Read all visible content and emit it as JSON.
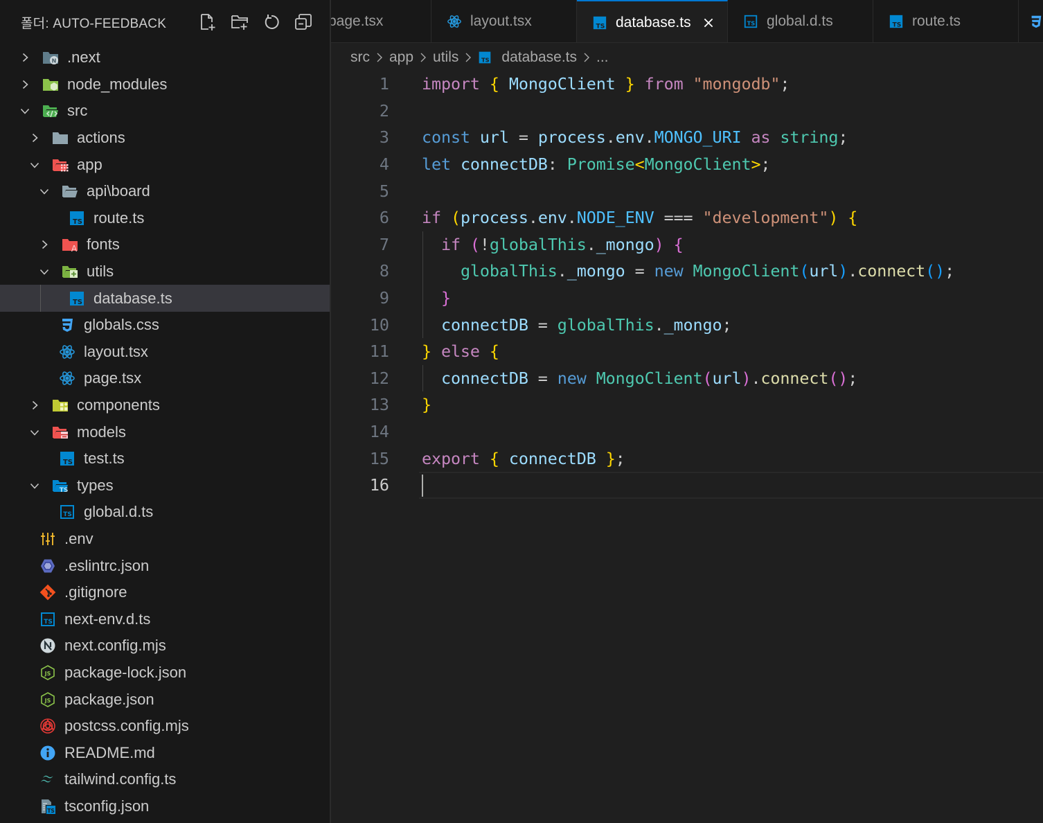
{
  "sidebar": {
    "title": "폴더: AUTO-FEEDBACK",
    "actions": [
      {
        "name": "new-file",
        "label": "New File"
      },
      {
        "name": "new-folder",
        "label": "New Folder"
      },
      {
        "name": "refresh",
        "label": "Refresh Explorer"
      },
      {
        "name": "collapse-all",
        "label": "Collapse Folders"
      }
    ],
    "tree": [
      {
        "label": ".next",
        "type": "folder",
        "depth": 0,
        "expanded": false,
        "icon": "next-folder-icon"
      },
      {
        "label": "node_modules",
        "type": "folder",
        "depth": 0,
        "expanded": false,
        "icon": "node-folder-icon"
      },
      {
        "label": "src",
        "type": "folder",
        "depth": 0,
        "expanded": true,
        "icon": "src-folder-icon"
      },
      {
        "label": "actions",
        "type": "folder",
        "depth": 1,
        "expanded": false,
        "icon": "folder-icon"
      },
      {
        "label": "app",
        "type": "folder",
        "depth": 1,
        "expanded": true,
        "icon": "app-folder-icon"
      },
      {
        "label": "api\\board",
        "type": "folder",
        "depth": 2,
        "expanded": true,
        "icon": "open-folder-icon"
      },
      {
        "label": "route.ts",
        "type": "file",
        "depth": 3,
        "icon": "typescript-icon"
      },
      {
        "label": "fonts",
        "type": "folder",
        "depth": 2,
        "expanded": false,
        "icon": "fonts-folder-icon"
      },
      {
        "label": "utils",
        "type": "folder",
        "depth": 2,
        "expanded": true,
        "icon": "utils-folder-icon"
      },
      {
        "label": "database.ts",
        "type": "file",
        "depth": 3,
        "icon": "typescript-icon",
        "selected": true
      },
      {
        "label": "globals.css",
        "type": "file",
        "depth": 2,
        "icon": "css-icon"
      },
      {
        "label": "layout.tsx",
        "type": "file",
        "depth": 2,
        "icon": "react-icon"
      },
      {
        "label": "page.tsx",
        "type": "file",
        "depth": 2,
        "icon": "react-icon"
      },
      {
        "label": "components",
        "type": "folder",
        "depth": 1,
        "expanded": false,
        "icon": "components-folder-icon"
      },
      {
        "label": "models",
        "type": "folder",
        "depth": 1,
        "expanded": true,
        "icon": "models-folder-icon"
      },
      {
        "label": "test.ts",
        "type": "file",
        "depth": 2,
        "icon": "typescript-icon"
      },
      {
        "label": "types",
        "type": "folder",
        "depth": 1,
        "expanded": true,
        "icon": "types-folder-icon"
      },
      {
        "label": "global.d.ts",
        "type": "file",
        "depth": 2,
        "icon": "typescript-def-icon"
      },
      {
        "label": ".env",
        "type": "file",
        "depth": 0,
        "icon": "env-icon"
      },
      {
        "label": ".eslintrc.json",
        "type": "file",
        "depth": 0,
        "icon": "eslint-icon"
      },
      {
        "label": ".gitignore",
        "type": "file",
        "depth": 0,
        "icon": "git-icon"
      },
      {
        "label": "next-env.d.ts",
        "type": "file",
        "depth": 0,
        "icon": "typescript-def-icon"
      },
      {
        "label": "next.config.mjs",
        "type": "file",
        "depth": 0,
        "icon": "nextjs-icon"
      },
      {
        "label": "package-lock.json",
        "type": "file",
        "depth": 0,
        "icon": "nodejs-icon"
      },
      {
        "label": "package.json",
        "type": "file",
        "depth": 0,
        "icon": "nodejs-icon"
      },
      {
        "label": "postcss.config.mjs",
        "type": "file",
        "depth": 0,
        "icon": "postcss-icon"
      },
      {
        "label": "README.md",
        "type": "file",
        "depth": 0,
        "icon": "info-icon"
      },
      {
        "label": "tailwind.config.ts",
        "type": "file",
        "depth": 0,
        "icon": "tailwind-icon"
      },
      {
        "label": "tsconfig.json",
        "type": "file",
        "depth": 0,
        "icon": "tsconfig-icon"
      }
    ]
  },
  "tabs": [
    {
      "label": "page.tsx",
      "icon": "react-icon",
      "active": false
    },
    {
      "label": "layout.tsx",
      "icon": "react-icon",
      "active": false
    },
    {
      "label": "database.ts",
      "icon": "typescript-icon",
      "active": true
    },
    {
      "label": "global.d.ts",
      "icon": "typescript-def-icon",
      "active": false
    },
    {
      "label": "route.ts",
      "icon": "typescript-icon",
      "active": false
    },
    {
      "label": "",
      "icon": "css-icon",
      "active": false
    }
  ],
  "breadcrumb": {
    "items": [
      "src",
      "app",
      "utils",
      "database.ts",
      "..."
    ]
  },
  "editor": {
    "current_line": 16,
    "lines": [
      [
        [
          "k",
          "import"
        ],
        [
          "p",
          " "
        ],
        [
          "b1",
          "{"
        ],
        [
          "p",
          " "
        ],
        [
          "v",
          "MongoClient"
        ],
        [
          "p",
          " "
        ],
        [
          "b1",
          "}"
        ],
        [
          "p",
          " "
        ],
        [
          "k",
          "from"
        ],
        [
          "p",
          " "
        ],
        [
          "s",
          "\"mongodb\""
        ],
        [
          "p",
          ";"
        ]
      ],
      [],
      [
        [
          "d",
          "const"
        ],
        [
          "p",
          " "
        ],
        [
          "v",
          "url"
        ],
        [
          "p",
          " = "
        ],
        [
          "v",
          "process"
        ],
        [
          "p",
          "."
        ],
        [
          "v",
          "env"
        ],
        [
          "p",
          "."
        ],
        [
          "c",
          "MONGO_URI"
        ],
        [
          "p",
          " "
        ],
        [
          "k",
          "as"
        ],
        [
          "p",
          " "
        ],
        [
          "t",
          "string"
        ],
        [
          "p",
          ";"
        ]
      ],
      [
        [
          "d",
          "let"
        ],
        [
          "p",
          " "
        ],
        [
          "v",
          "connectDB"
        ],
        [
          "p",
          ": "
        ],
        [
          "t",
          "Promise"
        ],
        [
          "b1",
          "<"
        ],
        [
          "t",
          "MongoClient"
        ],
        [
          "b1",
          ">"
        ],
        [
          "p",
          ";"
        ]
      ],
      [],
      [
        [
          "k",
          "if"
        ],
        [
          "p",
          " "
        ],
        [
          "b1",
          "("
        ],
        [
          "v",
          "process"
        ],
        [
          "p",
          "."
        ],
        [
          "v",
          "env"
        ],
        [
          "p",
          "."
        ],
        [
          "c",
          "NODE_ENV"
        ],
        [
          "p",
          " === "
        ],
        [
          "s",
          "\"development\""
        ],
        [
          "b1",
          ")"
        ],
        [
          "p",
          " "
        ],
        [
          "b1",
          "{"
        ]
      ],
      [
        [
          "p",
          "  "
        ],
        [
          "k",
          "if"
        ],
        [
          "p",
          " "
        ],
        [
          "b2",
          "("
        ],
        [
          "p",
          "!"
        ],
        [
          "t",
          "globalThis"
        ],
        [
          "p",
          "."
        ],
        [
          "v",
          "_mongo"
        ],
        [
          "b2",
          ")"
        ],
        [
          "p",
          " "
        ],
        [
          "b2",
          "{"
        ]
      ],
      [
        [
          "p",
          "    "
        ],
        [
          "t",
          "globalThis"
        ],
        [
          "p",
          "."
        ],
        [
          "v",
          "_mongo"
        ],
        [
          "p",
          " = "
        ],
        [
          "d",
          "new"
        ],
        [
          "p",
          " "
        ],
        [
          "t",
          "MongoClient"
        ],
        [
          "b3",
          "("
        ],
        [
          "v",
          "url"
        ],
        [
          "b3",
          ")"
        ],
        [
          "p",
          "."
        ],
        [
          "f",
          "connect"
        ],
        [
          "b3",
          "()"
        ],
        [
          "p",
          ";"
        ]
      ],
      [
        [
          "p",
          "  "
        ],
        [
          "b2",
          "}"
        ]
      ],
      [
        [
          "p",
          "  "
        ],
        [
          "v",
          "connectDB"
        ],
        [
          "p",
          " = "
        ],
        [
          "t",
          "globalThis"
        ],
        [
          "p",
          "."
        ],
        [
          "v",
          "_mongo"
        ],
        [
          "p",
          ";"
        ]
      ],
      [
        [
          "b1",
          "}"
        ],
        [
          "p",
          " "
        ],
        [
          "k",
          "else"
        ],
        [
          "p",
          " "
        ],
        [
          "b1",
          "{"
        ]
      ],
      [
        [
          "p",
          "  "
        ],
        [
          "v",
          "connectDB"
        ],
        [
          "p",
          " = "
        ],
        [
          "d",
          "new"
        ],
        [
          "p",
          " "
        ],
        [
          "t",
          "MongoClient"
        ],
        [
          "b2",
          "("
        ],
        [
          "v",
          "url"
        ],
        [
          "b2",
          ")"
        ],
        [
          "p",
          "."
        ],
        [
          "f",
          "connect"
        ],
        [
          "b2",
          "()"
        ],
        [
          "p",
          ";"
        ]
      ],
      [
        [
          "b1",
          "}"
        ]
      ],
      [],
      [
        [
          "k",
          "export"
        ],
        [
          "p",
          " "
        ],
        [
          "b1",
          "{"
        ],
        [
          "p",
          " "
        ],
        [
          "v",
          "connectDB"
        ],
        [
          "p",
          " "
        ],
        [
          "b1",
          "}"
        ],
        [
          "p",
          ";"
        ]
      ],
      []
    ]
  },
  "colors": {
    "accent": "#0078d4",
    "sidebar_bg": "#181818",
    "editor_bg": "#1f1f1f",
    "selected_row": "#37373d",
    "ts_blue": "#0288d1"
  }
}
